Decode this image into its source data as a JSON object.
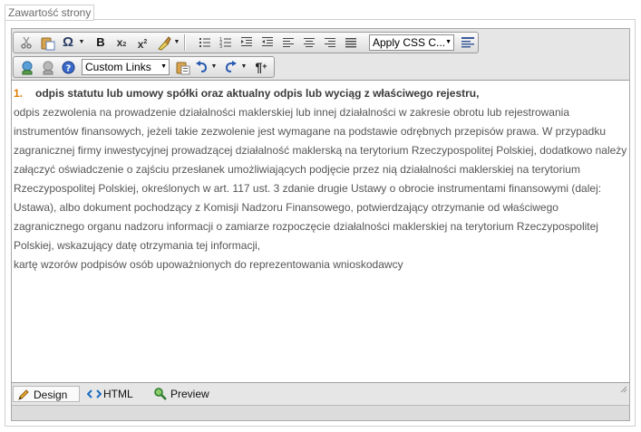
{
  "fieldset": {
    "legend": "Zawartość strony"
  },
  "toolbar": {
    "apply_css_label": "Apply CSS C...",
    "custom_links_label": "Custom Links",
    "icons": [
      "cut-icon",
      "paste-icon",
      "omega-icon",
      "bold-icon",
      "subscript-icon",
      "superscript-icon",
      "format-stripper-icon",
      "bulleted-list-icon",
      "numbered-list-icon",
      "indent-icon",
      "outdent-icon",
      "align-left-icon",
      "align-center-icon",
      "align-right-icon",
      "justify-icon",
      "paragraph-style-icon",
      "link-icon",
      "unlink-icon",
      "help-icon",
      "paste-plain-icon",
      "undo-icon",
      "redo-icon",
      "paragraph-mark-icon"
    ]
  },
  "content": {
    "item1_number": "1.",
    "item1_text": "odpis statutu lub umowy spółki oraz aktualny odpis lub wyciąg z właściwego rejestru,",
    "para1": "odpis zezwolenia na prowadzenie działalności maklerskiej lub innej działalności w zakresie obrotu lub rejestrowania instrumentów finansowych, jeżeli takie zezwolenie jest wymagane na podstawie odrębnych przepisów prawa. W przypadku zagranicznej firmy inwestycyjnej prowadzącej działalność maklerską na terytorium Rzeczypospolitej Polskiej, dodatkowo należy załączyć oświadczenie o zajściu przesłanek umożliwiających podjęcie przez nią działalności maklerskiej na terytorium Rzeczypospolitej Polskiej, określonych w art. 117 ust. 3 zdanie drugie Ustawy o obrocie instrumentami finansowymi (dalej: Ustawa), albo dokument pochodzący z Komisji Nadzoru Finansowego, potwierdzający otrzymanie od właściwego zagranicznego organu nadzoru informacji o zamiarze rozpoczęcie działalności maklerskiej na terytorium Rzeczypospolitej Polskiej, wskazujący datę otrzymania tej informacji,",
    "para2": "kartę wzorów podpisów osób upoważnionych do reprezentowania wnioskodawcy"
  },
  "modes": {
    "design": "Design",
    "html": "HTML",
    "preview": "Preview"
  },
  "colors": {
    "accent_number": "#e07b00",
    "border": "#9a9a9a",
    "toolbar_bg": "#e6e6e6"
  }
}
